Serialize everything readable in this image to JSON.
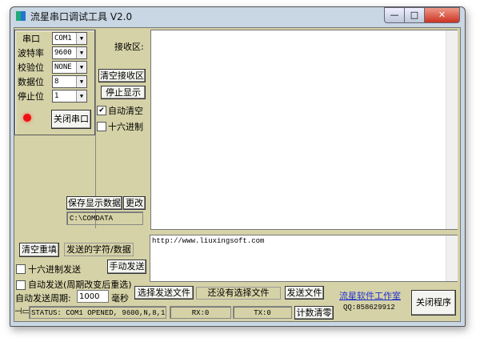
{
  "window": {
    "title": "流星串口调试工具 V2.0",
    "minimize": "—",
    "maximize": "□",
    "close": "✕"
  },
  "port": {
    "labels": [
      "串口",
      "波特率",
      "校验位",
      "数据位",
      "停止位"
    ],
    "values": [
      "COM1",
      "9600",
      "NONE",
      "8",
      "1"
    ],
    "toggle_button": "关闭串口",
    "led_color": "#ee1111"
  },
  "receive": {
    "label": "接收区:",
    "clear_button": "清空接收区",
    "stop_button": "停止显示",
    "auto_clear": "自动清空",
    "auto_clear_checked": true,
    "hex": "十六进制",
    "hex_checked": false,
    "content": ""
  },
  "save": {
    "save_button": "保存显示数据",
    "change_button": "更改",
    "path": "C:\\COMDATA"
  },
  "send": {
    "clear_button": "清空重填",
    "label": "发送的字符/数据",
    "manual_button": "手动发送",
    "hex_send": "十六进制发送",
    "auto_send": "自动发送(周期改变后重选)",
    "period_label": "自动发送周期:",
    "period_value": "1000",
    "period_unit": "毫秒",
    "content": "http://www.liuxingsoft.com"
  },
  "file": {
    "select_button": "选择发送文件",
    "status": "还没有选择文件",
    "send_button": "发送文件"
  },
  "about": {
    "link": "流星软件工作室",
    "qq": "QQ:858629912",
    "close_button": "关闭程序"
  },
  "status": {
    "text": "STATUS: COM1 OPENED, 9600,N,8,1",
    "rx": "RX:0",
    "tx": "TX:0",
    "reset_button": "计数清零"
  }
}
